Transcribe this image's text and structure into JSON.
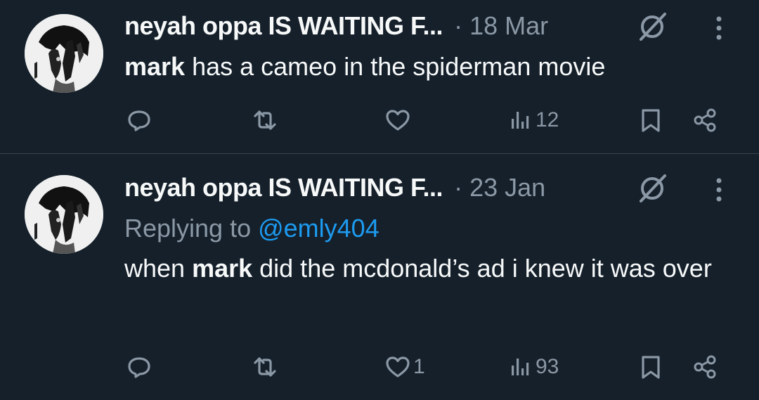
{
  "colors": {
    "background": "#15202b",
    "text": "#f7f9f9",
    "secondary": "#8b98a5",
    "link": "#1d9bf0",
    "divider": "#38444d"
  },
  "tweets": [
    {
      "author": "neyah oppa IS WAITING F...",
      "separator": "·",
      "date": "18 Mar",
      "text_bold": "mark",
      "text_rest": " has a cameo in the spiderman movie",
      "actions": {
        "reply_icon": "reply-icon",
        "retweet_icon": "retweet-icon",
        "like_icon": "heart-icon",
        "like_count": "",
        "views_icon": "views-icon",
        "views_count": "12",
        "bookmark_icon": "bookmark-icon",
        "share_icon": "share-icon"
      }
    },
    {
      "author": "neyah oppa IS WAITING F...",
      "separator": "·",
      "date": "23 Jan",
      "replying_to_prefix": "Replying to ",
      "replying_to_handle": "@emly404",
      "text_pre": "when ",
      "text_bold": "mark",
      "text_rest": " did the mcdonald’s ad i knew it was over",
      "actions": {
        "reply_icon": "reply-icon",
        "retweet_icon": "retweet-icon",
        "like_icon": "heart-icon",
        "like_count": "1",
        "views_icon": "views-icon",
        "views_count": "93",
        "bookmark_icon": "bookmark-icon",
        "share_icon": "share-icon"
      }
    }
  ]
}
